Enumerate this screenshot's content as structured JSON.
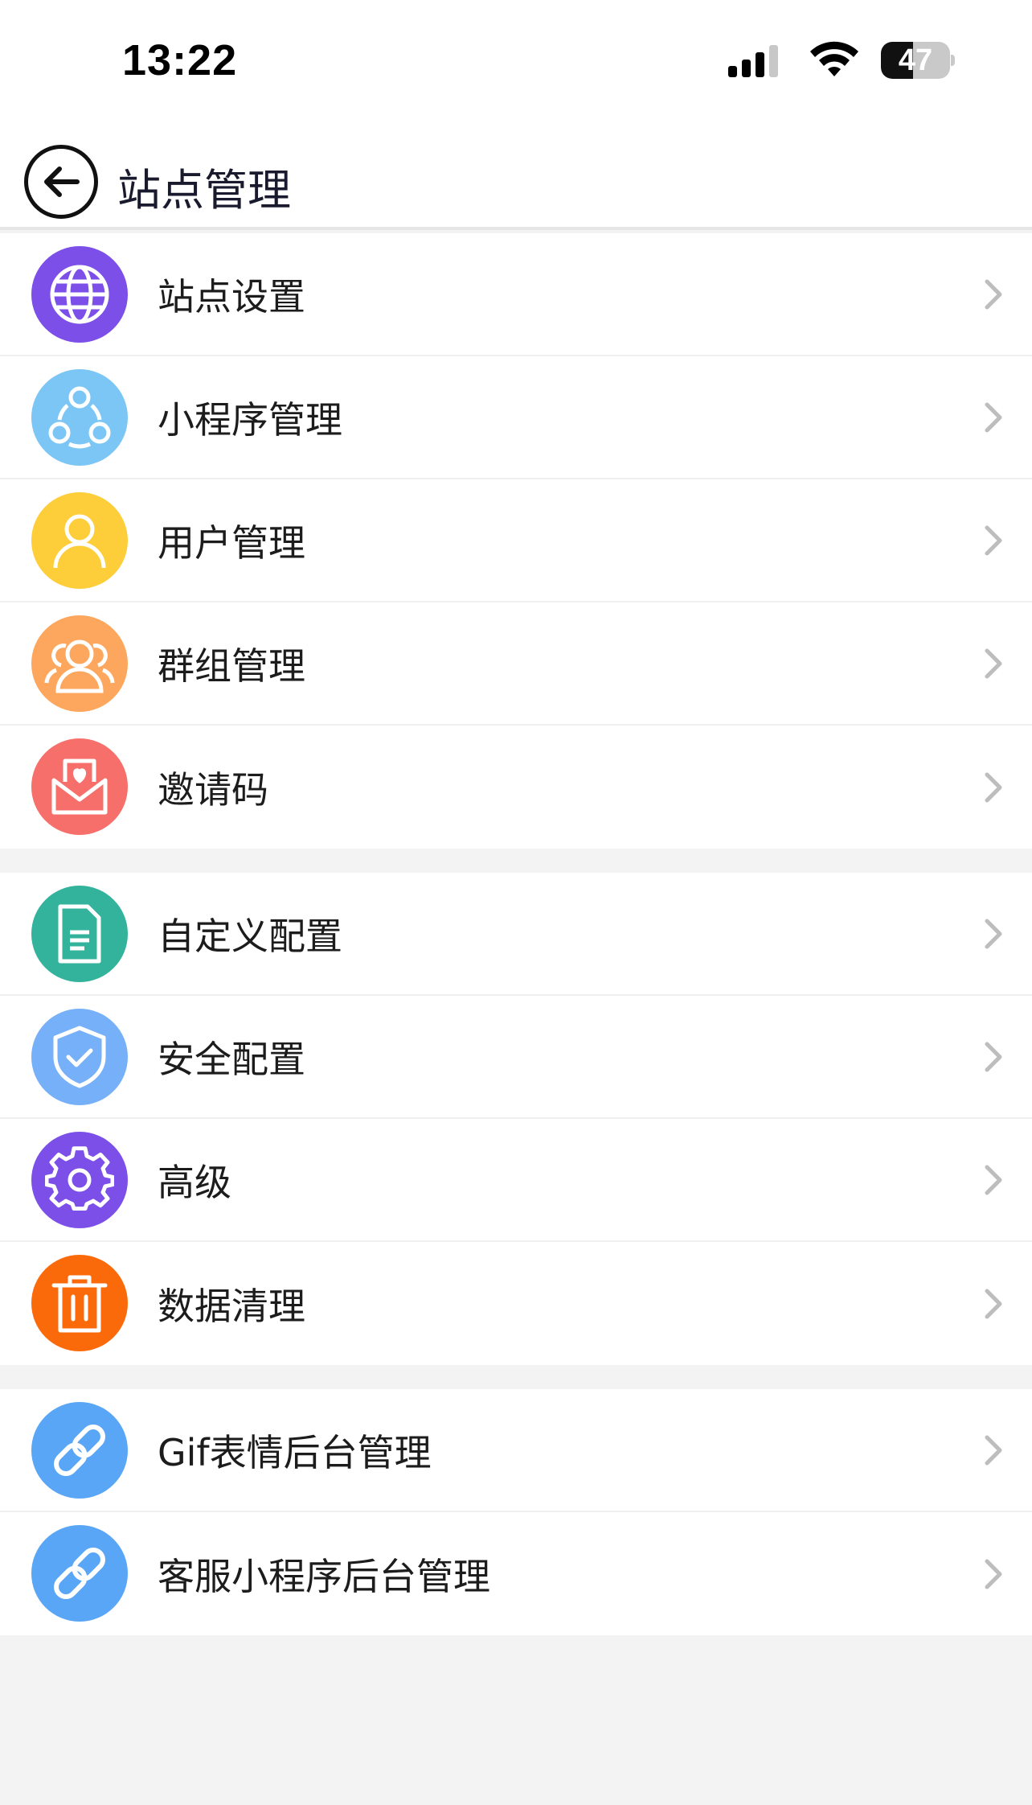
{
  "status_bar": {
    "time": "13:22",
    "battery_percent": "47",
    "battery_level": 47,
    "signal_bars": 3
  },
  "nav": {
    "title": "站点管理",
    "back_icon": "back-arrow-icon"
  },
  "groups": [
    {
      "items": [
        {
          "label": "站点设置",
          "icon": "globe-icon",
          "color": "#7b4fe8"
        },
        {
          "label": "小程序管理",
          "icon": "share-nodes-icon",
          "color": "#7cc6f5"
        },
        {
          "label": "用户管理",
          "icon": "user-icon",
          "color": "#fdcd3a"
        },
        {
          "label": "群组管理",
          "icon": "users-icon",
          "color": "#fca75d"
        },
        {
          "label": "邀请码",
          "icon": "envelope-heart-icon",
          "color": "#f66f6a"
        }
      ]
    },
    {
      "items": [
        {
          "label": "自定义配置",
          "icon": "document-icon",
          "color": "#33b39b"
        },
        {
          "label": "安全配置",
          "icon": "shield-check-icon",
          "color": "#76b0f8"
        },
        {
          "label": "高级",
          "icon": "gear-icon",
          "color": "#7b4fe8"
        },
        {
          "label": "数据清理",
          "icon": "trash-icon",
          "color": "#fb6a0a"
        }
      ]
    },
    {
      "items": [
        {
          "label": "Gif表情后台管理",
          "icon": "link-icon",
          "color": "#5aa6f6"
        },
        {
          "label": "客服小程序后台管理",
          "icon": "link-icon",
          "color": "#5aa6f6"
        }
      ]
    }
  ]
}
